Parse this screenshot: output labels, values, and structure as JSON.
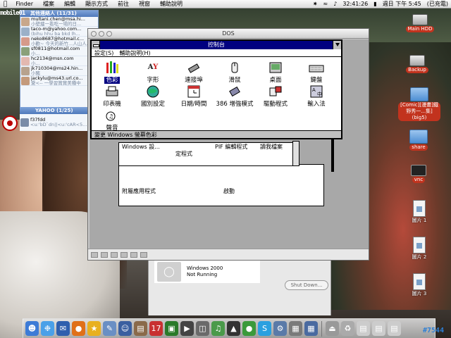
{
  "menubar": {
    "items": [
      "Finder",
      "檔案",
      "編輯",
      "顯示方式",
      "前往",
      "視窗",
      "輔助說明"
    ],
    "clock": "32:41:26",
    "datetime": "週日 下午 5:45",
    "battery": "(已充電)"
  },
  "messenger": {
    "group_title": "其他連絡人 (11/31)",
    "contacts": [
      {
        "name": "multani.chen@msa.hi...",
        "status": "小壁爐一看吃一場的日..."
      },
      {
        "name": "taco-m@yahoo.com...",
        "status": "(bihu hhu ba bkd lh..."
      },
      {
        "name": "neko8687@hotmail.c...",
        "status": "小歡~ 今天的新竹...人山人..."
      },
      {
        "name": "sf0811@hotmail.com",
        "status": "小..."
      },
      {
        "name": "hc2134@msn.com",
        "status": "小..."
      },
      {
        "name": "jk710304@ms24.hin...",
        "status": "小豬"
      },
      {
        "name": "jackylu@ms43.url.co...",
        "status": "愛<-- 一學習賞賞美種中"
      }
    ],
    "yahoo_title": "YAHOO (1/25)",
    "yahoo_contact": {
      "name": "f37fdd",
      "status": "<u:'bD`dn||<u:'cAR<5..."
    }
  },
  "dos_window": {
    "title": "DOS"
  },
  "control_panel": {
    "title": "控制台",
    "menu": [
      "設定(S)",
      "輔助說明(H)"
    ],
    "icons": [
      {
        "label": "色彩",
        "glyph": "crayons",
        "selected": true
      },
      {
        "label": "字形",
        "glyph": "fonts",
        "selected": false
      },
      {
        "label": "連接埠",
        "glyph": "ports",
        "selected": false
      },
      {
        "label": "滑鼠",
        "glyph": "mouse",
        "selected": false
      },
      {
        "label": "桌面",
        "glyph": "desktop",
        "selected": false
      },
      {
        "label": "鍵盤",
        "glyph": "keyboard",
        "selected": false
      },
      {
        "label": "印表機",
        "glyph": "printer",
        "selected": false
      },
      {
        "label": "國別設定",
        "glyph": "globe",
        "selected": false
      },
      {
        "label": "日期/時間",
        "glyph": "clock",
        "selected": false
      },
      {
        "label": "386 增強模式",
        "glyph": "chip",
        "selected": false
      },
      {
        "label": "驅動程式",
        "glyph": "drivers",
        "selected": false
      },
      {
        "label": "輸入法",
        "glyph": "ime",
        "selected": false
      },
      {
        "label": "聲音",
        "glyph": "sound",
        "selected": false
      }
    ],
    "status": "變更 Windows 螢幕色彩"
  },
  "program_manager": {
    "fragments": [
      {
        "text": "Windows 設..."
      },
      {
        "text": "定程式"
      },
      {
        "text": "PIF 編輯程式"
      },
      {
        "text": "讀我檔案"
      }
    ],
    "groups": [
      {
        "label": "附屬應用程式"
      },
      {
        "label": "啟動"
      }
    ]
  },
  "vm_list": {
    "name": "Windows 2000",
    "state": "Not Running",
    "shutdown_label": "Shut Down..."
  },
  "desktop_icons": [
    {
      "label": "Main HDD",
      "type": "hdd"
    },
    {
      "label": "Backup",
      "type": "hdd"
    },
    {
      "label": "[Comic][漫畫]鐵野秀一...集](big5)",
      "type": "folder"
    },
    {
      "label": "share",
      "type": "folder"
    },
    {
      "label": "vnc",
      "type": "app"
    },
    {
      "label": "圖片 1",
      "type": "file"
    },
    {
      "label": "圖片 2",
      "type": "file"
    },
    {
      "label": "圖片 3",
      "type": "file"
    }
  ],
  "overlay": {
    "logo_text": "mobile01",
    "badge": "#7544"
  }
}
